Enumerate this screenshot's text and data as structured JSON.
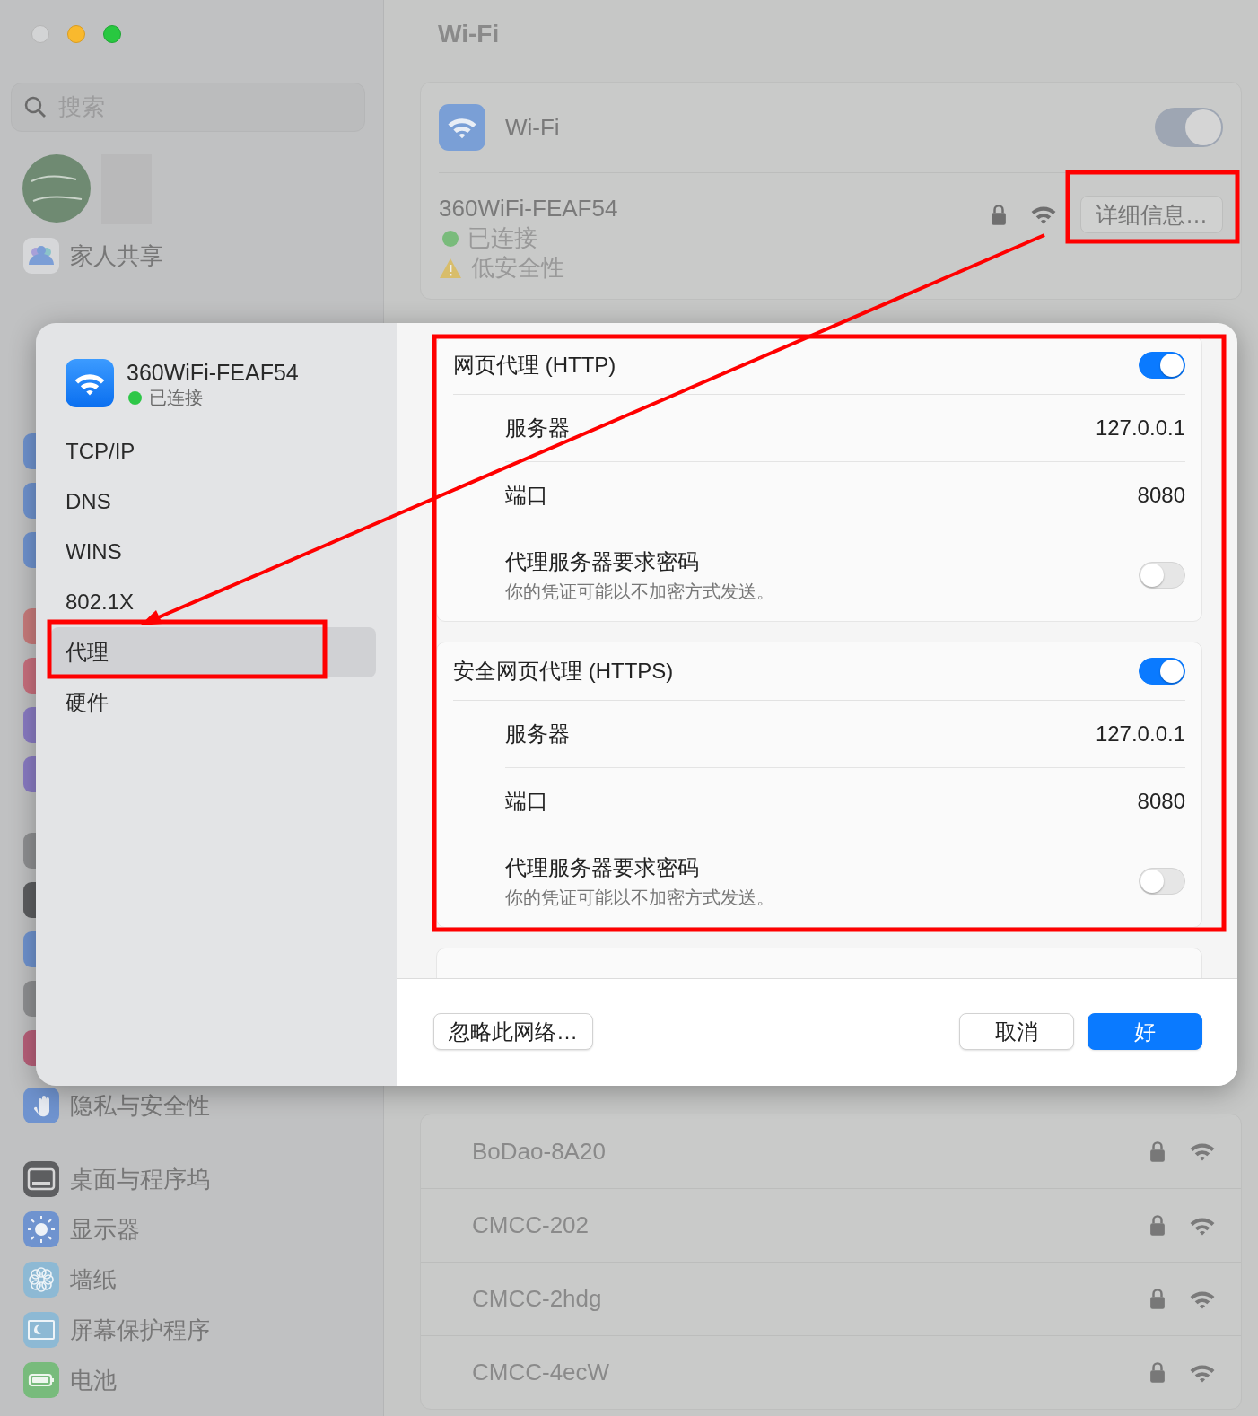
{
  "sidebar": {
    "search": {
      "placeholder": "搜索"
    },
    "account_items": [
      {
        "label": "家人共享"
      }
    ],
    "sections": [
      {
        "items": [
          {
            "label": "隐私与安全性"
          }
        ]
      },
      {
        "items": [
          {
            "label": "桌面与程序坞"
          },
          {
            "label": "显示器"
          },
          {
            "label": "墙纸"
          },
          {
            "label": "屏幕保护程序"
          },
          {
            "label": "电池"
          }
        ]
      }
    ]
  },
  "main": {
    "title": "Wi-Fi",
    "wifi": {
      "label": "Wi-Fi",
      "on": true
    },
    "current_network": {
      "name": "360WiFi-FEAF54",
      "status": "已连接",
      "security": "低安全性",
      "details_button": "详细信息…"
    },
    "other_networks": [
      {
        "name": "BoDao-8A20"
      },
      {
        "name": "CMCC-202"
      },
      {
        "name": "CMCC-2hdg"
      },
      {
        "name": "CMCC-4ecW"
      }
    ]
  },
  "dialog": {
    "network": {
      "name": "360WiFi-FEAF54",
      "status": "已连接"
    },
    "nav": [
      {
        "label": "TCP/IP",
        "selected": false
      },
      {
        "label": "DNS",
        "selected": false
      },
      {
        "label": "WINS",
        "selected": false
      },
      {
        "label": "802.1X",
        "selected": false
      },
      {
        "label": "代理",
        "selected": true
      },
      {
        "label": "硬件",
        "selected": false
      }
    ],
    "groups": [
      {
        "title": "网页代理 (HTTP)",
        "on": true,
        "rows": [
          {
            "kind": "value",
            "label": "服务器",
            "value": "127.0.0.1"
          },
          {
            "kind": "value",
            "label": "端口",
            "value": "8080"
          },
          {
            "kind": "toggle",
            "label": "代理服务器要求密码",
            "note": "你的凭证可能以不加密方式发送。",
            "on": false
          }
        ]
      },
      {
        "title": "安全网页代理 (HTTPS)",
        "on": true,
        "rows": [
          {
            "kind": "value",
            "label": "服务器",
            "value": "127.0.0.1"
          },
          {
            "kind": "value",
            "label": "端口",
            "value": "8080"
          },
          {
            "kind": "toggle",
            "label": "代理服务器要求密码",
            "note": "你的凭证可能以不加密方式发送。",
            "on": false
          }
        ]
      }
    ],
    "buttons": [
      {
        "label": "忽略此网络…",
        "kind": "secondary"
      },
      {
        "label": "取消",
        "kind": "secondary"
      },
      {
        "label": "好",
        "kind": "primary"
      }
    ]
  }
}
